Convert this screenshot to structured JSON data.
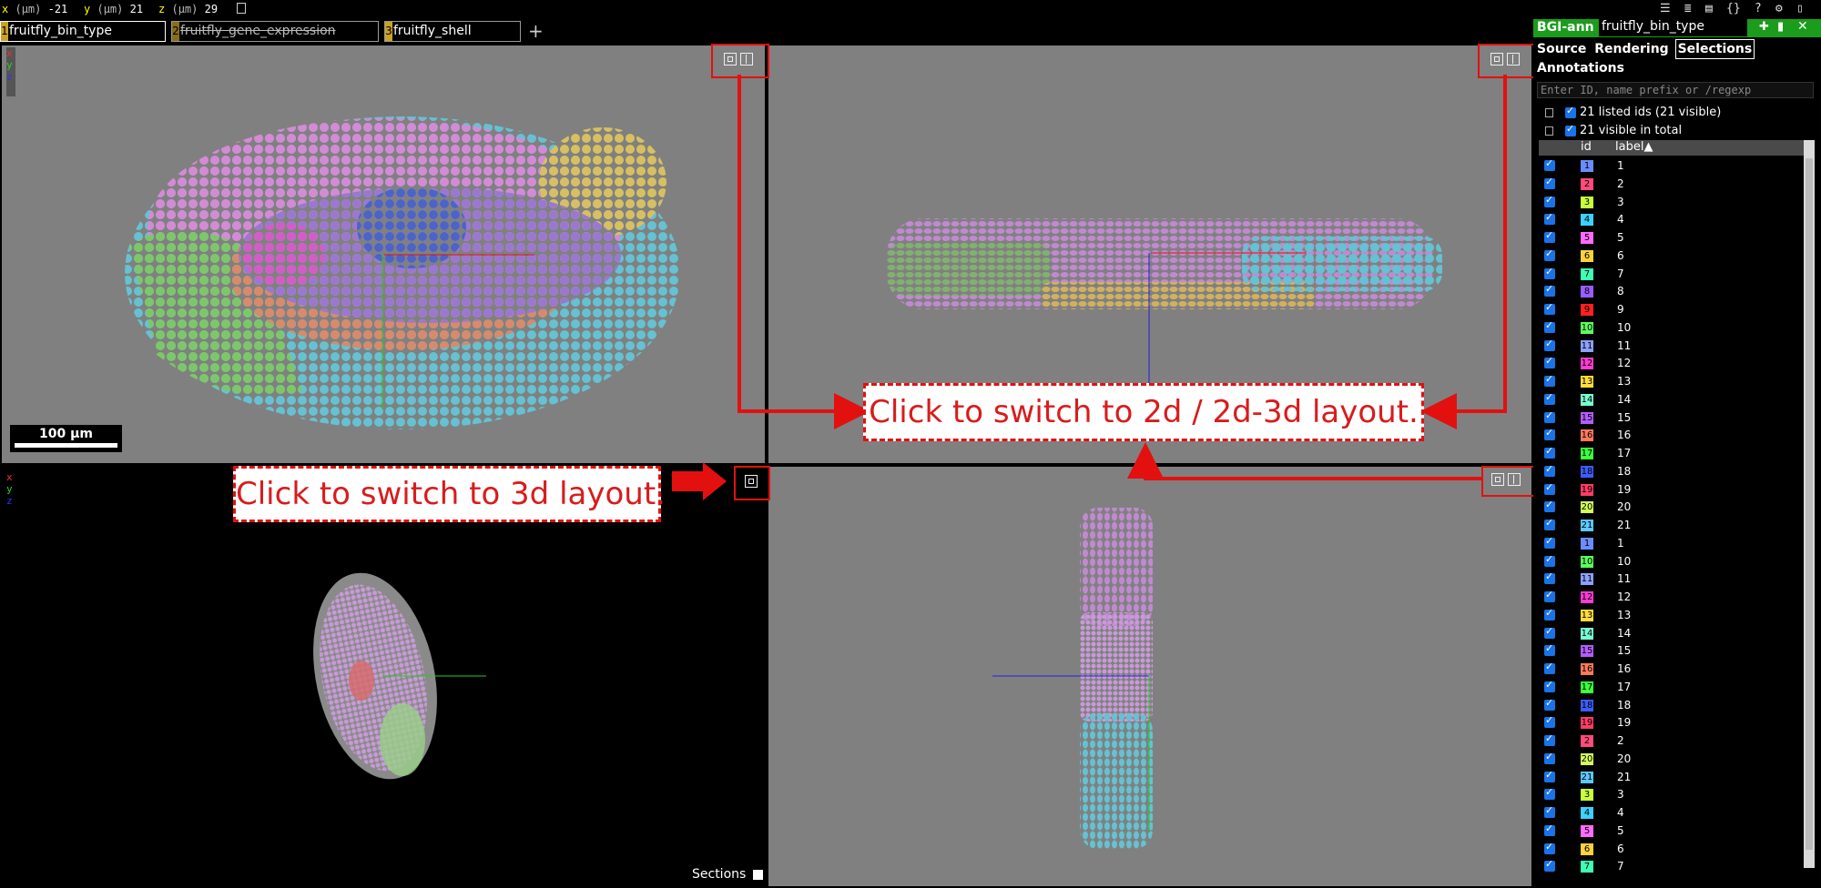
{
  "topbar": {
    "x_label": "x",
    "x_unit": "(μm)",
    "x_value": "-21",
    "y_label": "y",
    "y_unit": "(μm)",
    "y_value": "21",
    "z_label": "z",
    "z_unit": "(μm)",
    "z_value": "29"
  },
  "layers": [
    {
      "num": "1",
      "name": "fruitfly_bin_type",
      "visible": true
    },
    {
      "num": "2",
      "name": "fruitfly_gene_expression",
      "visible": false
    },
    {
      "num": "3",
      "name": "fruitfly_shell",
      "visible": true
    }
  ],
  "add_layer": "+",
  "scale_bar": "100 µm",
  "axis_letters": {
    "x": "x",
    "y": "y",
    "z": "z"
  },
  "annotations": {
    "layout_3d": "Click to switch to 3d layout.",
    "layout_2d": "Click to switch to 2d / 2d-3d layout."
  },
  "sections_label": "Sections",
  "side_panel": {
    "layer_group": "BGI-ann",
    "layer_name": "fruitfly_bin_type",
    "tabs": [
      "Source",
      "Rendering",
      "Selections",
      "Annotations"
    ],
    "active_tab": "Selections",
    "filter_placeholder": "Enter ID, name prefix or /regexp",
    "listed_summary": "21 listed ids (21 visible)",
    "visible_summary": "21 visible in total",
    "col_id": "id",
    "col_label": "label▲"
  },
  "segments": [
    {
      "id": "1",
      "label": "1",
      "color": "#6b8cff"
    },
    {
      "id": "2",
      "label": "2",
      "color": "#ff4a7a"
    },
    {
      "id": "3",
      "label": "3",
      "color": "#c8ff3c"
    },
    {
      "id": "4",
      "label": "4",
      "color": "#3cd2ff"
    },
    {
      "id": "5",
      "label": "5",
      "color": "#ff6bff"
    },
    {
      "id": "6",
      "label": "6",
      "color": "#ffd23c"
    },
    {
      "id": "7",
      "label": "7",
      "color": "#3cffb4"
    },
    {
      "id": "8",
      "label": "8",
      "color": "#9a5cff"
    },
    {
      "id": "9",
      "label": "9",
      "color": "#ff2020"
    },
    {
      "id": "10",
      "label": "10",
      "color": "#5cff5c"
    },
    {
      "id": "11",
      "label": "11",
      "color": "#8ca0ff"
    },
    {
      "id": "12",
      "label": "12",
      "color": "#ff3cd2"
    },
    {
      "id": "13",
      "label": "13",
      "color": "#ffdc3c"
    },
    {
      "id": "14",
      "label": "14",
      "color": "#7affd2"
    },
    {
      "id": "15",
      "label": "15",
      "color": "#b45cff"
    },
    {
      "id": "16",
      "label": "16",
      "color": "#ff7a5c"
    },
    {
      "id": "17",
      "label": "17",
      "color": "#3cff3c"
    },
    {
      "id": "18",
      "label": "18",
      "color": "#3c5cff"
    },
    {
      "id": "19",
      "label": "19",
      "color": "#ff3c64"
    },
    {
      "id": "20",
      "label": "20",
      "color": "#d2ff5c"
    },
    {
      "id": "21",
      "label": "21",
      "color": "#5cc8ff"
    },
    {
      "id": "1",
      "label": "1",
      "color": "#6b8cff"
    },
    {
      "id": "10",
      "label": "10",
      "color": "#5cff5c"
    },
    {
      "id": "11",
      "label": "11",
      "color": "#8ca0ff"
    },
    {
      "id": "12",
      "label": "12",
      "color": "#ff3cd2"
    },
    {
      "id": "13",
      "label": "13",
      "color": "#ffdc3c"
    },
    {
      "id": "14",
      "label": "14",
      "color": "#7affd2"
    },
    {
      "id": "15",
      "label": "15",
      "color": "#b45cff"
    },
    {
      "id": "16",
      "label": "16",
      "color": "#ff7a5c"
    },
    {
      "id": "17",
      "label": "17",
      "color": "#3cff3c"
    },
    {
      "id": "18",
      "label": "18",
      "color": "#3c5cff"
    },
    {
      "id": "19",
      "label": "19",
      "color": "#ff3c64"
    },
    {
      "id": "2",
      "label": "2",
      "color": "#ff4a7a"
    },
    {
      "id": "20",
      "label": "20",
      "color": "#d2ff5c"
    },
    {
      "id": "21",
      "label": "21",
      "color": "#5cc8ff"
    },
    {
      "id": "3",
      "label": "3",
      "color": "#c8ff3c"
    },
    {
      "id": "4",
      "label": "4",
      "color": "#3cd2ff"
    },
    {
      "id": "5",
      "label": "5",
      "color": "#ff6bff"
    },
    {
      "id": "6",
      "label": "6",
      "color": "#ffd23c"
    },
    {
      "id": "7",
      "label": "7",
      "color": "#3cffb4"
    }
  ],
  "colors": {
    "annotation_red": "#e31010",
    "panel_gray": "#808080",
    "header_green": "#1c9c1c"
  }
}
